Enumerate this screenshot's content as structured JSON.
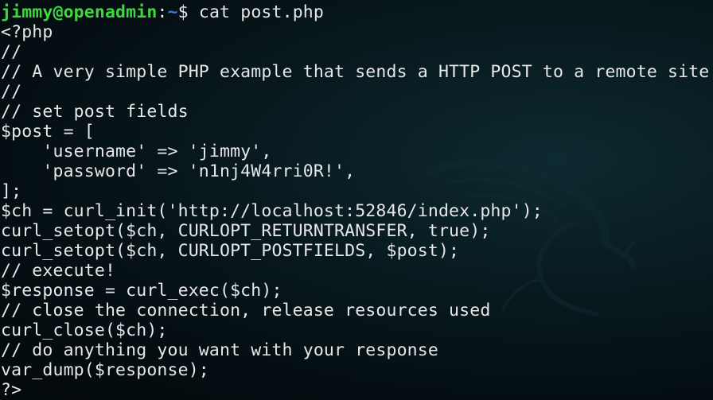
{
  "prompt": {
    "user_host": "jimmy@openadmin",
    "separator": ":",
    "path": "~",
    "symbol": "$",
    "command": " cat post.php"
  },
  "code_lines": [
    "<?php",
    "//",
    "// A very simple PHP example that sends a HTTP POST to a remote site",
    "//",
    "// set post fields",
    "$post = [",
    "    'username' => 'jimmy',",
    "    'password' => 'n1nj4W4rri0R!',",
    "];",
    "$ch = curl_init('http://localhost:52846/index.php');",
    "curl_setopt($ch, CURLOPT_RETURNTRANSFER, true);",
    "curl_setopt($ch, CURLOPT_POSTFIELDS, $post);",
    "// execute!",
    "$response = curl_exec($ch);",
    "// close the connection, release resources used",
    "curl_close($ch);",
    "// do anything you want with your response",
    "var_dump($response);",
    "?>"
  ],
  "colors": {
    "prompt_user": "#3fd63f",
    "prompt_path": "#3a7bd5",
    "text": "#e7e7e7",
    "background": "#071619"
  },
  "background_icon": "kali-dragon-icon"
}
